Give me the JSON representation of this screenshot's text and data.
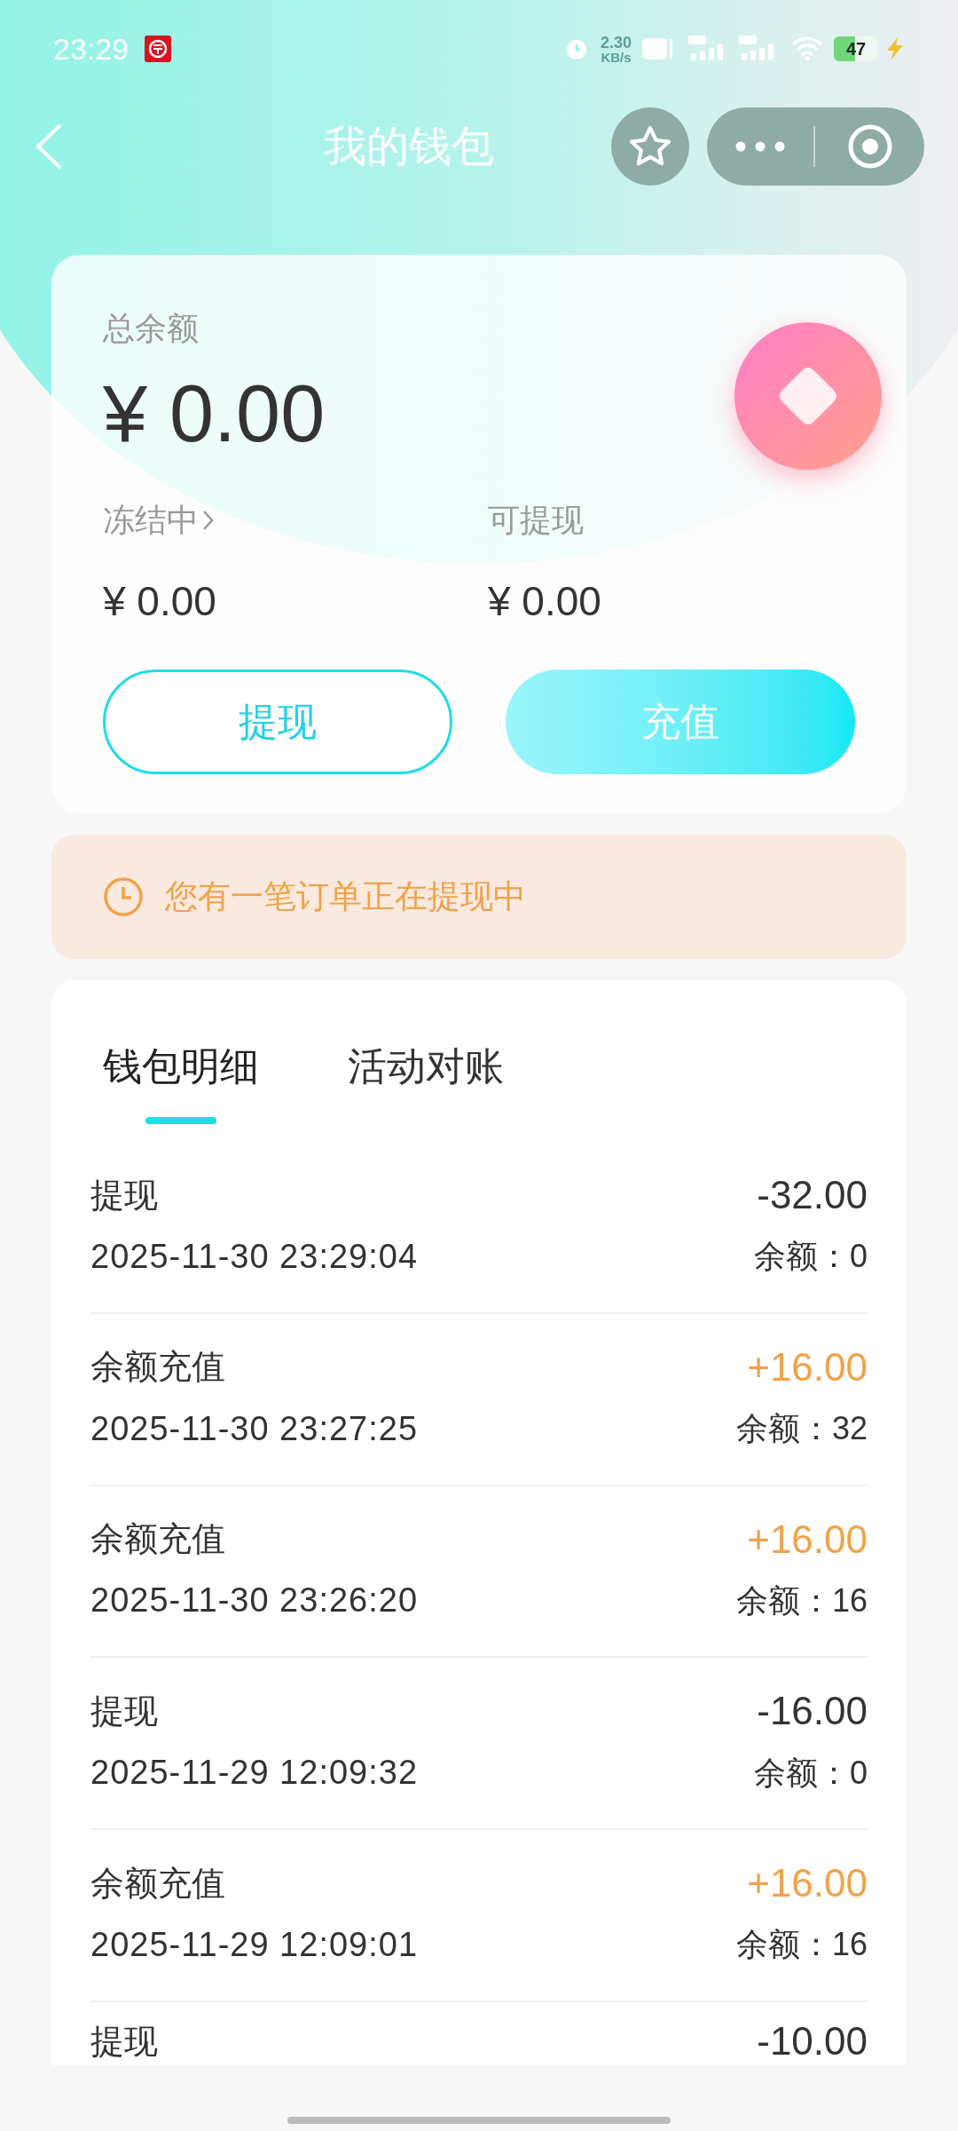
{
  "status_bar": {
    "time": "23:29",
    "speed": "2.30",
    "speed_unit": "KB/s",
    "battery": "47"
  },
  "header": {
    "title": "我的钱包"
  },
  "balance_card": {
    "label": "总余额",
    "amount": "¥ 0.00",
    "frozen_label": "冻结中",
    "frozen_amount": "¥ 0.00",
    "withdrawable_label": "可提现",
    "withdrawable_amount": "¥ 0.00",
    "buttons": [
      {
        "label": "提现",
        "kind": "outline"
      },
      {
        "label": "充值",
        "kind": "filled"
      }
    ]
  },
  "notice": {
    "text": "您有一笔订单正在提现中"
  },
  "tabs": [
    {
      "label": "钱包明细",
      "selected": true
    },
    {
      "label": "活动对账",
      "selected": false
    }
  ],
  "records": [
    {
      "title": "提现",
      "time": "2025-11-30 23:29:04",
      "amount": "-32.00",
      "kind": "expense",
      "balance": "余额：0"
    },
    {
      "title": "余额充值",
      "time": "2025-11-30 23:27:25",
      "amount": "+16.00",
      "kind": "income",
      "balance": "余额：32"
    },
    {
      "title": "余额充值",
      "time": "2025-11-30 23:26:20",
      "amount": "+16.00",
      "kind": "income",
      "balance": "余额：16"
    },
    {
      "title": "提现",
      "time": "2025-11-29 12:09:32",
      "amount": "-16.00",
      "kind": "expense",
      "balance": "余额：0"
    },
    {
      "title": "余额充值",
      "time": "2025-11-29 12:09:01",
      "amount": "+16.00",
      "kind": "income",
      "balance": "余额：16"
    },
    {
      "title": "提现",
      "amount": "-10.00",
      "kind": "expense"
    }
  ]
}
